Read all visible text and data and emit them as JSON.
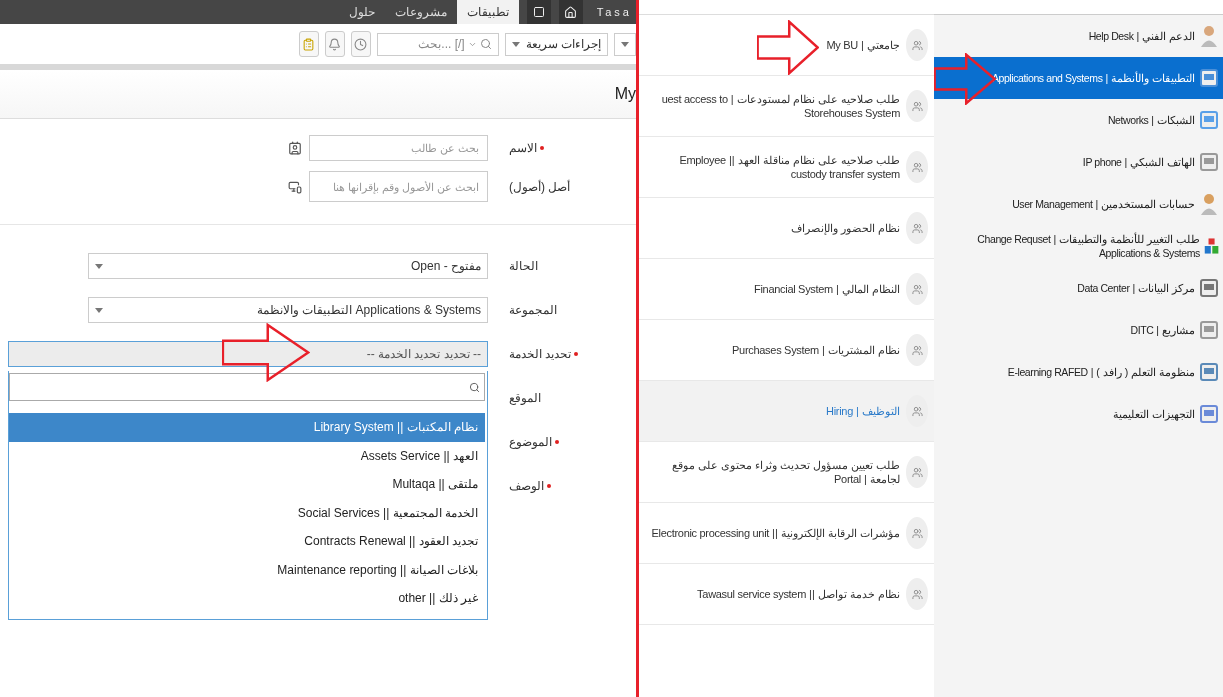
{
  "top_bar": {
    "logo": "Tasa",
    "tabs": [
      {
        "label": "تطبيقات",
        "selected": true
      },
      {
        "label": "مشروعات",
        "selected": false
      },
      {
        "label": "حلول",
        "selected": false
      }
    ]
  },
  "toolbar": {
    "quick_actions": "إجراءات سريعة",
    "search": {
      "placeholder": "بحث... [/]"
    }
  },
  "form": {
    "title": "My",
    "sections": [
      [
        {
          "kind": "lookup",
          "label": "الاسم",
          "required": true,
          "placeholder": "بحث عن طالب"
        },
        {
          "kind": "lookup",
          "label": "أصل (أصول)",
          "required": false,
          "placeholder": "ابحث عن الأصول وقم بإقرانها هنا"
        }
      ],
      [
        {
          "kind": "select",
          "label": "الحالة",
          "required": false,
          "value": "Open - مفتوح"
        },
        {
          "kind": "select",
          "label": "المجموعة",
          "required": false,
          "value": "التطبيقات والانظمة Applications & Systems"
        },
        {
          "kind": "combo",
          "label": "تحديد الخدمة",
          "required": true,
          "value": "-- تحديد تحديد الخدمة --",
          "expanded": true,
          "options": [
            {
              "label": "نظام المكتبات || Library System",
              "selected": true
            },
            {
              "label": "العهد || Assets Service",
              "selected": false
            },
            {
              "label": "ملتقى || Multaqa",
              "selected": false
            },
            {
              "label": "الخدمة المجتمعية || Social Services",
              "selected": false
            },
            {
              "label": "تجديد العقود || Contracts Renewal",
              "selected": false
            },
            {
              "label": "بلاغات الصيانة || Maintenance reporting",
              "selected": false
            },
            {
              "label": "غير ذلك || other",
              "selected": false
            }
          ]
        },
        {
          "kind": "label",
          "label": "الموقع",
          "required": false
        },
        {
          "kind": "label",
          "label": "الموضوع",
          "required": true
        },
        {
          "kind": "label",
          "label": "الوصف",
          "required": true
        }
      ]
    ]
  },
  "services": [
    {
      "label": "جامعتي | My BU",
      "selected": false
    },
    {
      "label": "طلب صلاحيه على نظام لمستودعات | uest access to Storehouses System",
      "selected": false
    },
    {
      "label": "طلب صلاحيه على نظام مناقلة العهد || Employee custody transfer system",
      "selected": false
    },
    {
      "label": "نظام الحضور والإنصراف",
      "selected": false
    },
    {
      "label": "النظام المالي | Financial System",
      "selected": false
    },
    {
      "label": "نظام المشتريات | Purchases System",
      "selected": false
    },
    {
      "label": "التوظيف | Hiring",
      "selected": true
    },
    {
      "label": "طلب تعيين مسؤول تحديث وثراء محتوى على موقع لجامعة | Portal",
      "selected": false
    },
    {
      "label": "مؤشرات الرقابة الإلكترونية || Electronic processing unit",
      "selected": false
    },
    {
      "label": "نظام خدمة تواصل || Tawasul service system",
      "selected": false
    }
  ],
  "categories": [
    {
      "label": "الدعم الفني | Help Desk",
      "selected": false
    },
    {
      "label": "التطبيقات والأنظمة | Applications and Systems",
      "selected": true
    },
    {
      "label": "الشبكات | Networks",
      "selected": false
    },
    {
      "label": "الهاتف الشبكي | IP phone",
      "selected": false
    },
    {
      "label": "حسابات المستخدمين | User Management",
      "selected": false
    },
    {
      "label": "طلب التغيير للأنظمة والتطبيقات | Change Requset Applications & Systems",
      "selected": false
    },
    {
      "label": "مركز البيانات | Data Center",
      "selected": false
    },
    {
      "label": "مشاريع | DITC",
      "selected": false
    },
    {
      "label": "منظومة التعلم ( رافد ) | E-learning RAFED",
      "selected": false
    },
    {
      "label": "التجهيزات التعليمية",
      "selected": false
    }
  ]
}
